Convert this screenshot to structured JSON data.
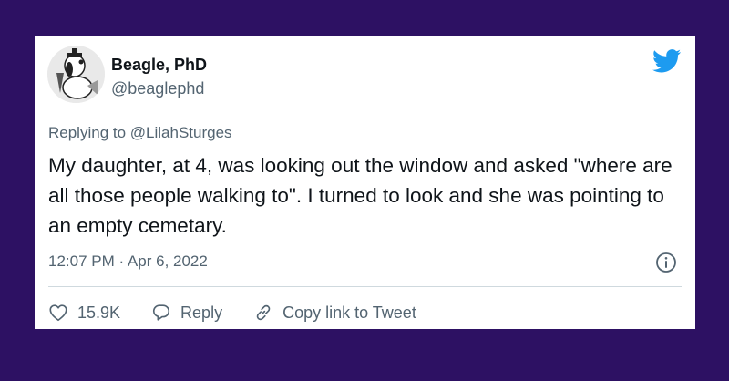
{
  "tweet": {
    "display_name": "Beagle, PhD",
    "handle": "@beaglephd",
    "replying_prefix": "Replying to ",
    "replying_to": "@LilahSturges",
    "text": "My daughter, at 4, was looking out the window and asked \"where are all those people walking to\". I turned to look and she was pointing to an empty cemetary.",
    "timestamp": "12:07 PM · Apr 6, 2022"
  },
  "actions": {
    "like_count": "15.9K",
    "reply_label": "Reply",
    "copy_link_label": "Copy link to Tweet"
  },
  "colors": {
    "background": "#2d1163",
    "card": "#ffffff",
    "twitter_blue": "#1d9bf0",
    "secondary_text": "#536471"
  }
}
